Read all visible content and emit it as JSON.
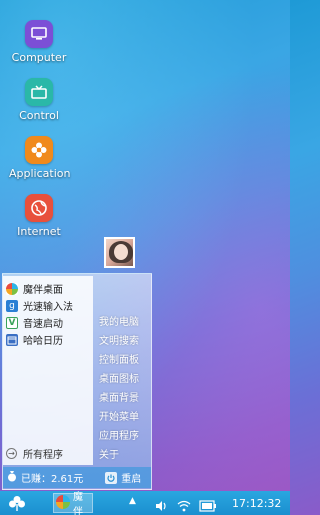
{
  "desktop": {
    "icons": [
      {
        "label": "Computer",
        "icon": "monitor-icon",
        "color": "#7c4fd6"
      },
      {
        "label": "Control",
        "icon": "tv-icon",
        "color": "#2ab8a8"
      },
      {
        "label": "Application",
        "icon": "flower-icon",
        "color": "#f08a1c"
      },
      {
        "label": "Internet",
        "icon": "globe-icon",
        "color": "#e8503c"
      }
    ]
  },
  "start_menu": {
    "apps": [
      {
        "label": "魔伴桌面",
        "icon": "pinwheel-icon"
      },
      {
        "label": "光速输入法",
        "icon": "keyboard-g-icon"
      },
      {
        "label": "音速启动",
        "icon": "v-launcher-icon"
      },
      {
        "label": "哈哈日历",
        "icon": "calendar-icon"
      }
    ],
    "all_programs": "所有程序",
    "right_items": [
      "我的电脑",
      "文明搜索",
      "控制面板",
      "桌面图标",
      "桌面背景",
      "开始菜单",
      "应用程序",
      "关于"
    ],
    "status_text": "已赚：2.61元",
    "restart_label": "重启"
  },
  "taskbar": {
    "active_app": "魔伴",
    "clock": "17:12:32"
  },
  "colors": {
    "taskbar": "#1f9ad6",
    "accent": "#2aa7e0"
  }
}
